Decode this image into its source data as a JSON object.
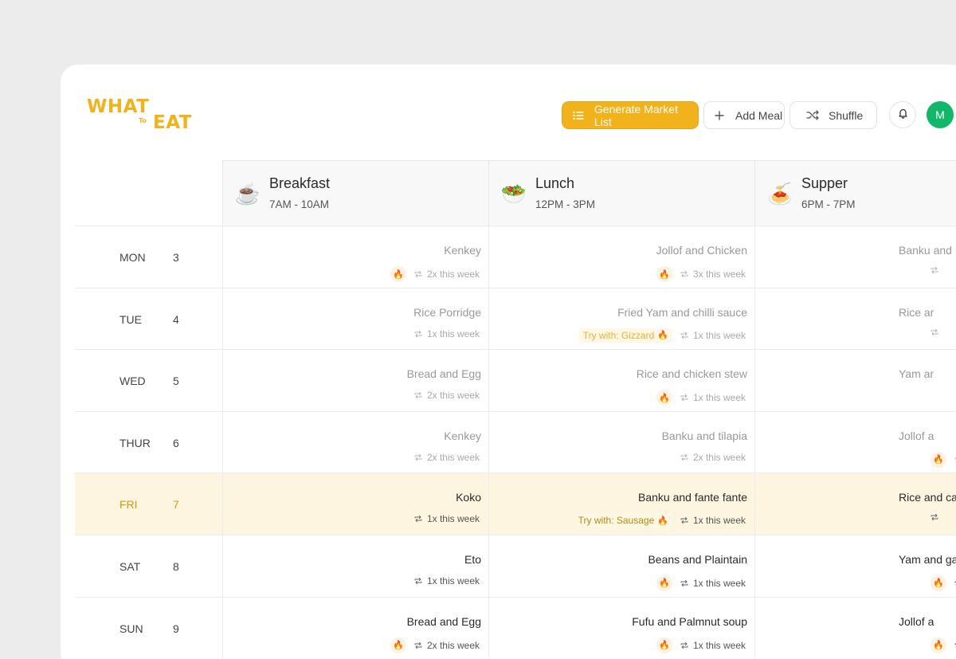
{
  "logo": {
    "word1": "WHAT",
    "word2": "To",
    "word3": "EAT"
  },
  "toolbar": {
    "generate_label": "Generate Market List",
    "add_label": "Add Meal",
    "shuffle_label": "Shuffle",
    "avatar_initial": "M"
  },
  "meals": [
    {
      "name": "Breakfast",
      "time": "7AM - 10AM",
      "emoji": "☕"
    },
    {
      "name": "Lunch",
      "time": "12PM - 3PM",
      "emoji": "🥗"
    },
    {
      "name": "Supper",
      "time": "6PM - 7PM",
      "emoji": "🍝"
    }
  ],
  "days": [
    {
      "day": "MON",
      "date": "3",
      "breakfast": {
        "dish": "Kenkey",
        "repeat": "2x this week"
      },
      "lunch": {
        "dish": "Jollof and Chicken",
        "repeat": "3x this week"
      },
      "supper": {
        "dish": "Banku and"
      }
    },
    {
      "day": "TUE",
      "date": "4",
      "breakfast": {
        "dish": "Rice Porridge",
        "repeat": "1x this week"
      },
      "lunch": {
        "dish": "Fried Yam and chilli sauce",
        "try": "Try with: Gizzard",
        "repeat": "1x this week"
      },
      "supper": {
        "dish": "Rice ar"
      }
    },
    {
      "day": "WED",
      "date": "5",
      "breakfast": {
        "dish": "Bread and Egg",
        "repeat": "2x this week"
      },
      "lunch": {
        "dish": "Rice and chicken stew",
        "repeat": "1x this week"
      },
      "supper": {
        "dish": "Yam ar"
      }
    },
    {
      "day": "THUR",
      "date": "6",
      "breakfast": {
        "dish": "Kenkey",
        "repeat": "2x this week"
      },
      "lunch": {
        "dish": "Banku and tilapia",
        "repeat": "2x this week"
      },
      "supper": {
        "dish": "Jollof a"
      }
    },
    {
      "day": "FRI",
      "date": "7",
      "breakfast": {
        "dish": "Koko",
        "repeat": "1x this week"
      },
      "lunch": {
        "dish": "Banku and fante fante",
        "try": "Try with: Sausage",
        "repeat": "1x this week"
      },
      "supper": {
        "dish": "Rice and ca"
      }
    },
    {
      "day": "SAT",
      "date": "8",
      "breakfast": {
        "dish": "Eto",
        "repeat": "1x this week"
      },
      "lunch": {
        "dish": "Beans and Plaintain",
        "repeat": "1x this week"
      },
      "supper": {
        "dish": "Yam and garde"
      }
    },
    {
      "day": "SUN",
      "date": "9",
      "breakfast": {
        "dish": "Bread and Egg",
        "repeat": "2x this week"
      },
      "lunch": {
        "dish": "Fufu and Palmnut soup",
        "repeat": "1x this week"
      },
      "supper": {
        "dish": "Jollof a"
      }
    }
  ],
  "colors": {
    "accent": "#f2b21b",
    "avatar": "#12b76a",
    "highlight_row": "#fdf5e0"
  }
}
